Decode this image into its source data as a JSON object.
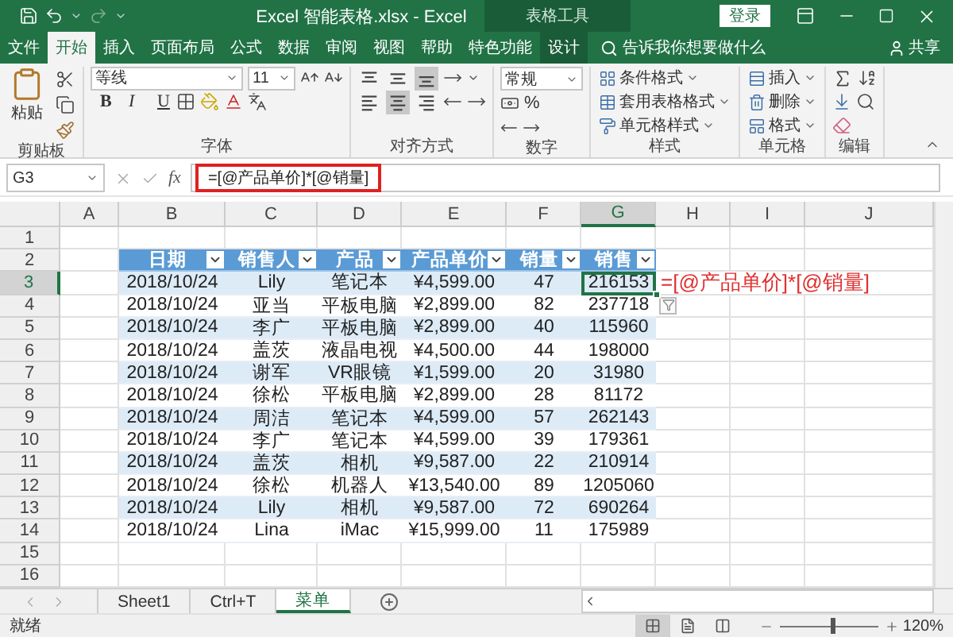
{
  "window": {
    "title": "Excel 智能表格.xlsx  -  Excel",
    "context_label": "表格工具",
    "sign_in": "登录"
  },
  "tabs": [
    {
      "label": "文件",
      "selected": false,
      "kind": "normal"
    },
    {
      "label": "开始",
      "selected": true,
      "kind": "normal"
    },
    {
      "label": "插入",
      "selected": false,
      "kind": "normal"
    },
    {
      "label": "页面布局",
      "selected": false,
      "kind": "normal"
    },
    {
      "label": "公式",
      "selected": false,
      "kind": "normal"
    },
    {
      "label": "数据",
      "selected": false,
      "kind": "normal"
    },
    {
      "label": "审阅",
      "selected": false,
      "kind": "normal"
    },
    {
      "label": "视图",
      "selected": false,
      "kind": "normal"
    },
    {
      "label": "帮助",
      "selected": false,
      "kind": "normal"
    },
    {
      "label": "特色功能",
      "selected": false,
      "kind": "normal"
    },
    {
      "label": "设计",
      "selected": false,
      "kind": "contextual"
    }
  ],
  "search": {
    "placeholder": "告诉我你想要做什么"
  },
  "share": "共享",
  "ribbon": {
    "groups": [
      {
        "kind": "clipboard",
        "label": "剪贴板",
        "paste": "粘贴"
      },
      {
        "kind": "font",
        "label": "字体",
        "font_name": "等线",
        "font_size": "11",
        "buttons": [
          "B",
          "I",
          "U"
        ]
      },
      {
        "kind": "alignment",
        "label": "对齐方式",
        "buttons": [
          {
            "kind": "top",
            "selected": false
          },
          {
            "kind": "middle",
            "selected": false
          },
          {
            "kind": "bottom",
            "selected": true
          },
          {
            "kind": "left",
            "selected": false
          },
          {
            "kind": "center",
            "selected": true
          },
          {
            "kind": "right",
            "selected": false
          }
        ]
      },
      {
        "kind": "number",
        "label": "数字",
        "format": "常规",
        "percent": "%"
      },
      {
        "kind": "styles",
        "label": "样式",
        "items": [
          "条件格式",
          "套用表格格式",
          "单元格样式"
        ]
      },
      {
        "kind": "cells",
        "label": "单元格",
        "items": [
          "插入",
          "删除",
          "格式"
        ]
      },
      {
        "kind": "editing",
        "label": "编辑"
      }
    ]
  },
  "formula_bar": {
    "name_box": "G3",
    "fx": "fx",
    "formula": "=[@产品单价]*[@销量]",
    "highlighted": true
  },
  "sheet": {
    "columns": [
      {
        "label": "A",
        "selected": false
      },
      {
        "label": "B",
        "selected": false
      },
      {
        "label": "C",
        "selected": false
      },
      {
        "label": "D",
        "selected": false
      },
      {
        "label": "E",
        "selected": false
      },
      {
        "label": "F",
        "selected": false
      },
      {
        "label": "G",
        "selected": true
      },
      {
        "label": "H",
        "selected": false
      },
      {
        "label": "I",
        "selected": false
      },
      {
        "label": "J",
        "selected": false
      }
    ],
    "rows": [
      {
        "label": "1",
        "selected": false
      },
      {
        "label": "2",
        "selected": false
      },
      {
        "label": "3",
        "selected": true
      },
      {
        "label": "4",
        "selected": false
      },
      {
        "label": "5",
        "selected": false
      },
      {
        "label": "6",
        "selected": false
      },
      {
        "label": "7",
        "selected": false
      },
      {
        "label": "8",
        "selected": false
      },
      {
        "label": "9",
        "selected": false
      },
      {
        "label": "10",
        "selected": false
      },
      {
        "label": "11",
        "selected": false
      },
      {
        "label": "12",
        "selected": false
      },
      {
        "label": "13",
        "selected": false
      },
      {
        "label": "14",
        "selected": false
      },
      {
        "label": "15",
        "selected": false
      },
      {
        "label": "16",
        "selected": false
      }
    ],
    "table": {
      "headers": [
        "日期",
        "销售人",
        "产品",
        "产品单价",
        "销量",
        "销售"
      ],
      "rows": [
        {
          "cells": [
            "2018/10/24",
            "Lily",
            "笔记本",
            "¥4,599.00",
            "47",
            "216153"
          ],
          "amount_active": true
        },
        {
          "cells": [
            "2018/10/24",
            "亚当",
            "平板电脑",
            "¥2,899.00",
            "82",
            "237718"
          ],
          "amount_active": false
        },
        {
          "cells": [
            "2018/10/24",
            "李广",
            "平板电脑",
            "¥2,899.00",
            "40",
            "115960"
          ],
          "amount_active": false
        },
        {
          "cells": [
            "2018/10/24",
            "盖茨",
            "液晶电视",
            "¥4,500.00",
            "44",
            "198000"
          ],
          "amount_active": false
        },
        {
          "cells": [
            "2018/10/24",
            "谢军",
            "VR眼镜",
            "¥1,599.00",
            "20",
            "31980"
          ],
          "amount_active": false
        },
        {
          "cells": [
            "2018/10/24",
            "徐松",
            "平板电脑",
            "¥2,899.00",
            "28",
            "81172"
          ],
          "amount_active": false
        },
        {
          "cells": [
            "2018/10/24",
            "周洁",
            "笔记本",
            "¥4,599.00",
            "57",
            "262143"
          ],
          "amount_active": false
        },
        {
          "cells": [
            "2018/10/24",
            "李广",
            "笔记本",
            "¥4,599.00",
            "39",
            "179361"
          ],
          "amount_active": false
        },
        {
          "cells": [
            "2018/10/24",
            "盖茨",
            "相机",
            "¥9,587.00",
            "22",
            "210914"
          ],
          "amount_active": false
        },
        {
          "cells": [
            "2018/10/24",
            "徐松",
            "机器人",
            "¥13,540.00",
            "89",
            "1205060"
          ],
          "amount_active": false
        },
        {
          "cells": [
            "2018/10/24",
            "Lily",
            "相机",
            "¥9,587.00",
            "72",
            "690264"
          ],
          "amount_active": false
        },
        {
          "cells": [
            "2018/10/24",
            "Lina",
            "iMac",
            "¥15,999.00",
            "11",
            "175989"
          ],
          "amount_active": false
        }
      ]
    },
    "annotation": "=[@产品单价]*[@销量]"
  },
  "sheet_tabs": [
    {
      "label": "Sheet1",
      "selected": false
    },
    {
      "label": "Ctrl+T",
      "selected": false
    },
    {
      "label": "菜单",
      "selected": true
    }
  ],
  "status_bar": {
    "status": "就绪",
    "views": [
      {
        "kind": "normal",
        "selected": true
      },
      {
        "kind": "page_layout",
        "selected": false
      },
      {
        "kind": "page_break",
        "selected": false
      }
    ],
    "zoom": {
      "level": 0.53,
      "reading": "120%"
    }
  }
}
